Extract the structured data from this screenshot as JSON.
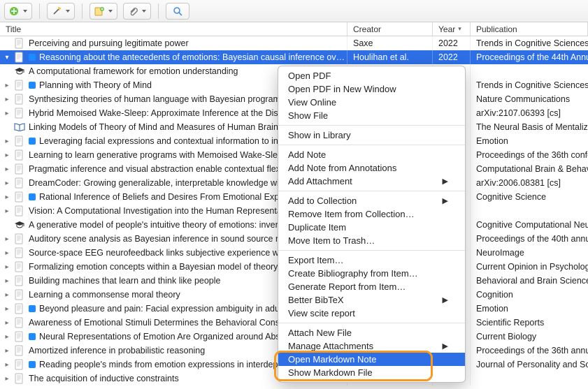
{
  "toolbar": {
    "new_item": "New Item",
    "wand": "Lookup",
    "new_note": "New Note",
    "attach": "Add Attachment",
    "search": "Search"
  },
  "columns": {
    "title": "Title",
    "creator": "Creator",
    "year": "Year",
    "publication": "Publication"
  },
  "rows": [
    {
      "expand": "none",
      "icon": "page",
      "tag": "",
      "title": "Perceiving and pursuing legitimate power",
      "creator": "Saxe",
      "year": "2022",
      "pub": "Trends in Cognitive Sciences"
    },
    {
      "expand": "open",
      "icon": "page",
      "tag": "blue",
      "title": "Reasoning about the antecedents of emotions: Bayesian causal inference over a...",
      "creator": "Houlihan et al.",
      "year": "2022",
      "pub": "Proceedings of the 44th Annu",
      "selected": true
    },
    {
      "expand": "none",
      "icon": "cap",
      "tag": "",
      "title": "A computational framework for emotion understanding",
      "creator": "",
      "year": "",
      "pub": ""
    },
    {
      "expand": "closed",
      "icon": "page",
      "tag": "blue",
      "title": "Planning with Theory of Mind",
      "creator": "",
      "year": "",
      "pub": "Trends in Cognitive Sciences"
    },
    {
      "expand": "closed",
      "icon": "page",
      "tag": "",
      "title": "Synthesizing theories of human language with Bayesian program",
      "creator": "",
      "year": "",
      "pub": "Nature Communications"
    },
    {
      "expand": "closed",
      "icon": "page",
      "tag": "",
      "title": "Hybrid Memoised Wake-Sleep: Approximate Inference at the Disc",
      "creator": "",
      "year": "",
      "pub": "arXiv:2107.06393 [cs]"
    },
    {
      "expand": "none",
      "icon": "book",
      "tag": "",
      "title": "Linking Models of Theory of Mind and Measures of Human Brain A",
      "creator": "",
      "year": "",
      "pub": "The Neural Basis of Mentalizin"
    },
    {
      "expand": "closed",
      "icon": "page",
      "tag": "blue",
      "title": "Leveraging facial expressions and contextual information to inv",
      "creator": "",
      "year": "",
      "pub": "Emotion"
    },
    {
      "expand": "closed",
      "icon": "page",
      "tag": "",
      "title": "Learning to learn generative programs with Memoised Wake-Slee",
      "creator": "",
      "year": "",
      "pub": "Proceedings of the 36th confe"
    },
    {
      "expand": "closed",
      "icon": "page",
      "tag": "",
      "title": "Pragmatic inference and visual abstraction enable contextual flex",
      "creator": "",
      "year": "",
      "pub": "Computational Brain & Behavi"
    },
    {
      "expand": "closed",
      "icon": "page",
      "tag": "",
      "title": "DreamCoder: Growing generalizable, interpretable knowledge wit",
      "creator": "",
      "year": "",
      "pub": "arXiv:2006.08381 [cs]"
    },
    {
      "expand": "closed",
      "icon": "page",
      "tag": "blue",
      "title": "Rational Inference of Beliefs and Desires From Emotional Expre",
      "creator": "",
      "year": "",
      "pub": "Cognitive Science"
    },
    {
      "expand": "closed",
      "icon": "page",
      "tag": "",
      "title": "Vision: A Computational Investigation into the Human Representa",
      "creator": "",
      "year": "",
      "pub": ""
    },
    {
      "expand": "none",
      "icon": "cap",
      "tag": "",
      "title": "A generative model of people's intuitive theory of emotions: inver",
      "creator": "",
      "year": "",
      "pub": "Cognitive Computational Neur"
    },
    {
      "expand": "closed",
      "icon": "page",
      "tag": "",
      "title": "Auditory scene analysis as Bayesian inference in sound source m",
      "creator": "",
      "year": "",
      "pub": "Proceedings of the 40th annu"
    },
    {
      "expand": "closed",
      "icon": "page",
      "tag": "",
      "title": "Source-space EEG neurofeedback links subjective experience with",
      "creator": "",
      "year": "",
      "pub": "NeuroImage"
    },
    {
      "expand": "closed",
      "icon": "page",
      "tag": "",
      "title": "Formalizing emotion concepts within a Bayesian model of theory",
      "creator": "",
      "year": "",
      "pub": "Current Opinion in Psychology"
    },
    {
      "expand": "closed",
      "icon": "page",
      "tag": "",
      "title": "Building machines that learn and think like people",
      "creator": "",
      "year": "",
      "pub": "Behavioral and Brain Sciences"
    },
    {
      "expand": "closed",
      "icon": "page",
      "tag": "",
      "title": "Learning a commonsense moral theory",
      "creator": "",
      "year": "",
      "pub": "Cognition"
    },
    {
      "expand": "closed",
      "icon": "page",
      "tag": "blue",
      "title": "Beyond pleasure and pain: Facial expression ambiguity in adult",
      "creator": "",
      "year": "",
      "pub": "Emotion"
    },
    {
      "expand": "closed",
      "icon": "page",
      "tag": "",
      "title": "Awareness of Emotional Stimuli Determines the Behavioral Conse",
      "creator": "",
      "year": "",
      "pub": "Scientific Reports"
    },
    {
      "expand": "closed",
      "icon": "page",
      "tag": "blue",
      "title": "Neural Representations of Emotion Are Organized around Abstra",
      "creator": "",
      "year": "",
      "pub": "Current Biology"
    },
    {
      "expand": "closed",
      "icon": "page",
      "tag": "",
      "title": "Amortized inference in probabilistic reasoning",
      "creator": "",
      "year": "",
      "pub": "Proceedings of the 36th annu"
    },
    {
      "expand": "closed",
      "icon": "page",
      "tag": "blue",
      "title": "Reading people's minds from emotion expressions in interdepe",
      "creator": "",
      "year": "",
      "pub": "Journal of Personality and Soc"
    },
    {
      "expand": "closed",
      "icon": "page",
      "tag": "",
      "title": "The acquisition of inductive constraints",
      "creator": "",
      "year": "",
      "pub": ""
    }
  ],
  "menu": {
    "items": [
      {
        "label": "Open PDF"
      },
      {
        "label": "Open PDF in New Window"
      },
      {
        "label": "View Online"
      },
      {
        "label": "Show File"
      },
      {
        "sep": true
      },
      {
        "label": "Show in Library"
      },
      {
        "sep": true
      },
      {
        "label": "Add Note"
      },
      {
        "label": "Add Note from Annotations"
      },
      {
        "label": "Add Attachment",
        "sub": true
      },
      {
        "sep": true
      },
      {
        "label": "Add to Collection",
        "sub": true
      },
      {
        "label": "Remove Item from Collection…"
      },
      {
        "label": "Duplicate Item"
      },
      {
        "label": "Move Item to Trash…"
      },
      {
        "sep": true
      },
      {
        "label": "Export Item…"
      },
      {
        "label": "Create Bibliography from Item…"
      },
      {
        "label": "Generate Report from Item…"
      },
      {
        "label": "Better BibTeX",
        "sub": true
      },
      {
        "label": "View scite report"
      },
      {
        "sep": true
      },
      {
        "label": "Attach New File"
      },
      {
        "label": "Manage Attachments",
        "sub": true
      },
      {
        "label": "Open Markdown Note",
        "highlight": true
      },
      {
        "label": "Show Markdown File"
      }
    ]
  }
}
